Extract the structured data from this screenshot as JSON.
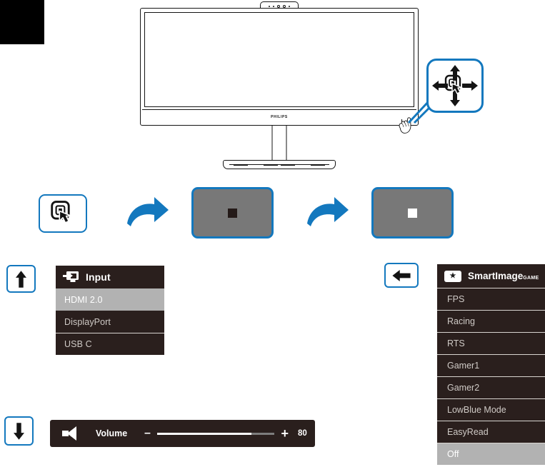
{
  "page": {
    "product": "PHILIPS",
    "monitor_logo": "PHILIPS"
  },
  "callouts": {
    "joystick": {
      "icon": "joystick-press-icon",
      "up": "arrow-up-icon",
      "down": "arrow-down-icon",
      "left": "arrow-left-icon",
      "right": "arrow-right-icon"
    },
    "press_button": {
      "icon": "joystick-press-icon"
    },
    "key_up": "arrow-up-icon",
    "key_down": "arrow-down-icon",
    "key_back": "arrow-left-icon",
    "step_arrow_1": "curved-arrow-right-icon",
    "step_arrow_2": "curved-arrow-right-icon"
  },
  "screens": [
    {
      "name": "screen-dark-square",
      "square_color": "#241a18",
      "background": "#787878"
    },
    {
      "name": "screen-light-square",
      "square_color": "#ffffff",
      "background": "#787878"
    }
  ],
  "input_menu": {
    "icon": "input-source-icon",
    "title": "Input",
    "items": [
      {
        "label": "HDMI 2.0",
        "selected": true,
        "divider": false
      },
      {
        "label": "DisplayPort",
        "selected": false,
        "divider": false
      },
      {
        "label": "USB C",
        "selected": false,
        "divider": true
      }
    ]
  },
  "volume_osd": {
    "icon": "speaker-icon",
    "label": "Volume",
    "minus": "–",
    "plus": "+",
    "value": "80",
    "percent": 80
  },
  "smartimage_menu": {
    "icon": "star-icon",
    "icon_glyph": "★",
    "title": "SmartImage",
    "title_superscript": "GAME",
    "items": [
      {
        "label": "FPS",
        "selected": false
      },
      {
        "label": "Racing",
        "selected": false
      },
      {
        "label": "RTS",
        "selected": false
      },
      {
        "label": "Gamer1",
        "selected": false
      },
      {
        "label": "Gamer2",
        "selected": false
      },
      {
        "label": "LowBlue Mode",
        "selected": false
      },
      {
        "label": "EasyRead",
        "selected": false
      },
      {
        "label": "Off",
        "selected": true
      }
    ]
  },
  "colors": {
    "accent_blue": "#1378be",
    "osd_background": "#2a1f1d",
    "osd_selected": "#b2b2b2",
    "osd_text": "#cfcac6",
    "screen_gray": "#787878"
  }
}
